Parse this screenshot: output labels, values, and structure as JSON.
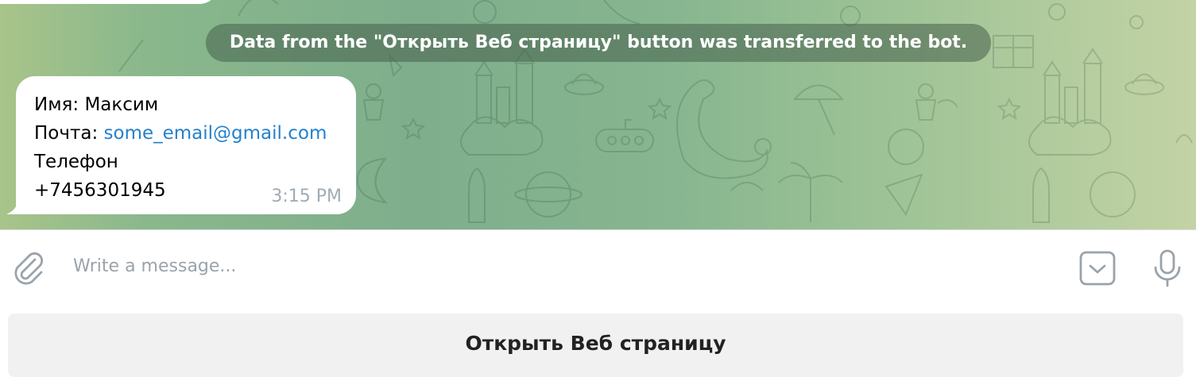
{
  "service_message": {
    "text": "Data from the \"Открыть Веб страницу\" button was transferred to the bot."
  },
  "message": {
    "lines": {
      "name": "Имя: Максим",
      "email_label": "Почта: ",
      "email_value": "some_email@gmail.com",
      "phone_label": "Телефон",
      "phone_value": "+7456301945"
    },
    "time": "3:15 PM"
  },
  "composer": {
    "placeholder": "Write a message...",
    "attach_icon": "paperclip-icon",
    "keyboard_icon": "keyboard-toggle-icon",
    "mic_icon": "microphone-icon"
  },
  "keyboard_button": {
    "label": "Открыть Веб страницу"
  },
  "colors": {
    "link": "#2481cc",
    "time": "#a0acb6",
    "service_pill": "rgba(70,95,75,0.55)",
    "wallpaper_start": "#a8c48a",
    "wallpaper_end": "#c3d3a5",
    "button_bg": "#f1f1f1"
  }
}
